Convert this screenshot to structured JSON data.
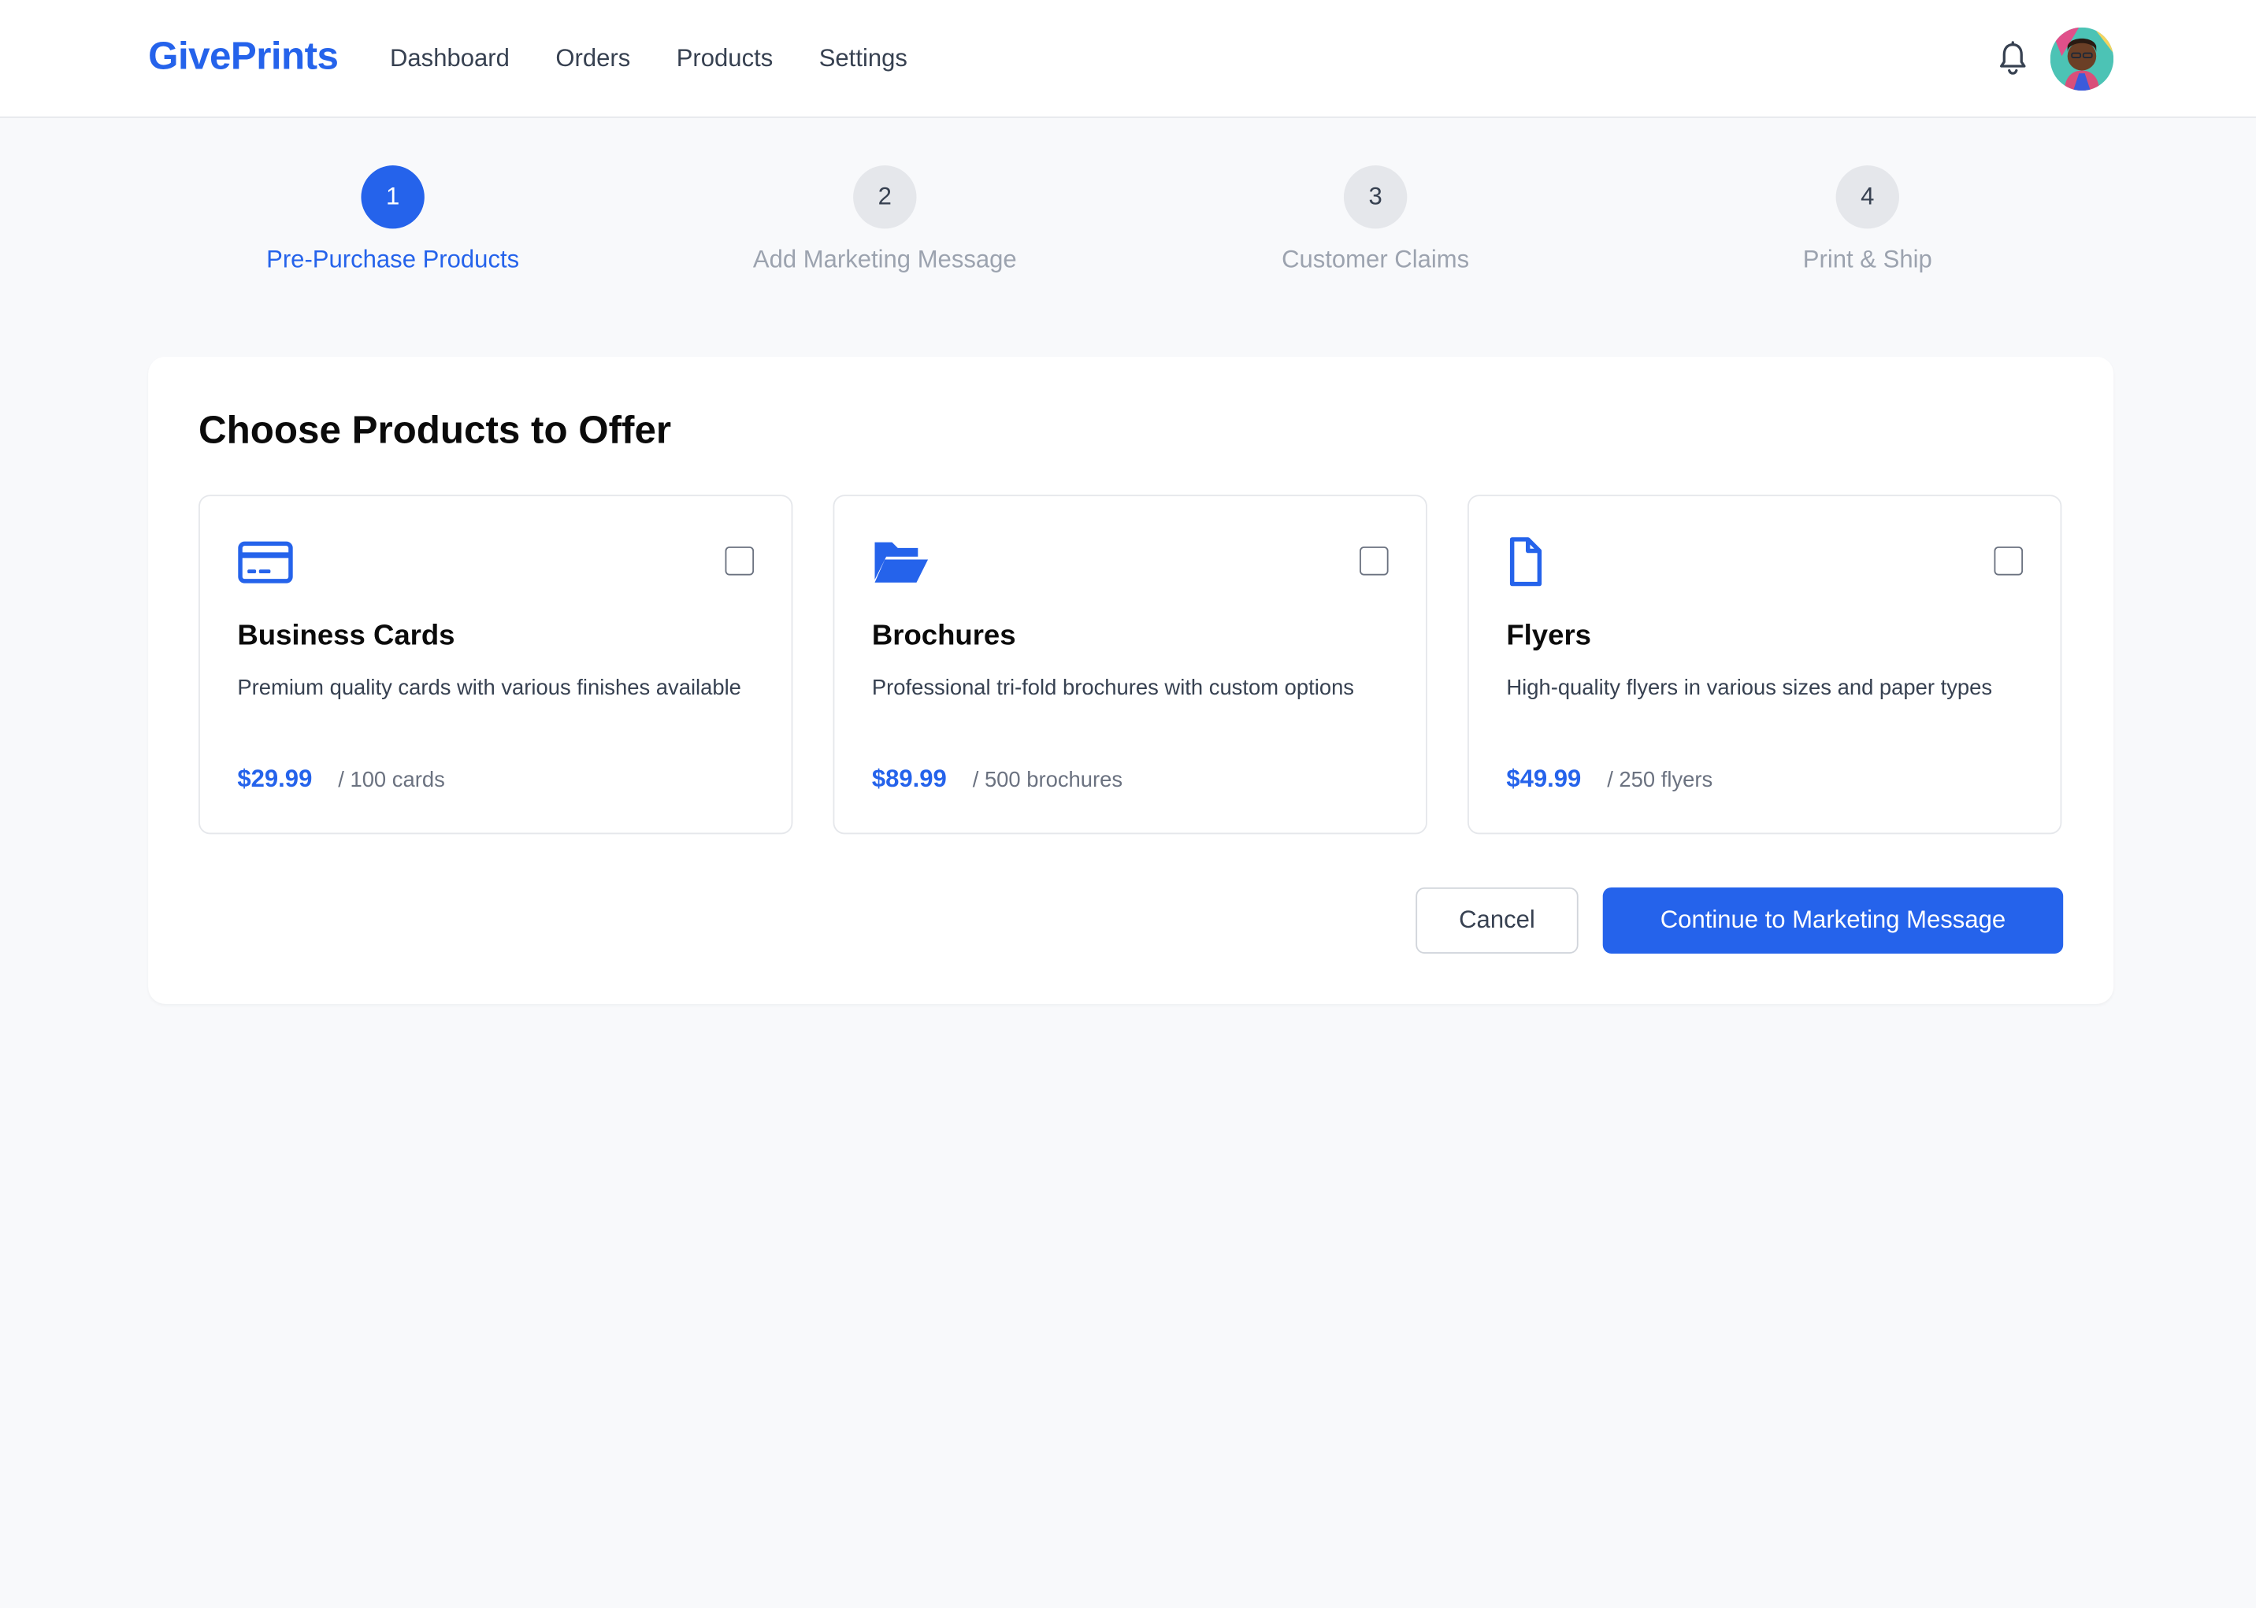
{
  "colors": {
    "accent": "#2563eb",
    "inactive_step_bg": "#e5e7eb",
    "inactive_step_text": "#9ca3af",
    "step_number_inactive": "#374151"
  },
  "header": {
    "logo": "GivePrints",
    "nav": [
      "Dashboard",
      "Orders",
      "Products",
      "Settings"
    ],
    "bell_icon": "bell-icon",
    "avatar": "user-avatar"
  },
  "steps": [
    {
      "number": "1",
      "label": "Pre-Purchase Products",
      "active": true
    },
    {
      "number": "2",
      "label": "Add Marketing Message",
      "active": false
    },
    {
      "number": "3",
      "label": "Customer Claims",
      "active": false
    },
    {
      "number": "4",
      "label": "Print & Ship",
      "active": false
    }
  ],
  "main": {
    "title": "Choose Products to Offer",
    "products": [
      {
        "icon": "credit-card-icon",
        "name": "Business Cards",
        "description": "Premium quality cards with various finishes available",
        "price": "$29.99",
        "unit": "/ 100 cards",
        "checked": false
      },
      {
        "icon": "folder-open-icon",
        "name": "Brochures",
        "description": "Professional tri-fold brochures with custom options",
        "price": "$89.99",
        "unit": "/ 500 brochures",
        "checked": false
      },
      {
        "icon": "file-icon",
        "name": "Flyers",
        "description": "High-quality flyers in various sizes and paper types",
        "price": "$49.99",
        "unit": "/ 250 flyers",
        "checked": false
      }
    ],
    "cancel_label": "Cancel",
    "continue_label": "Continue to Marketing Message"
  }
}
